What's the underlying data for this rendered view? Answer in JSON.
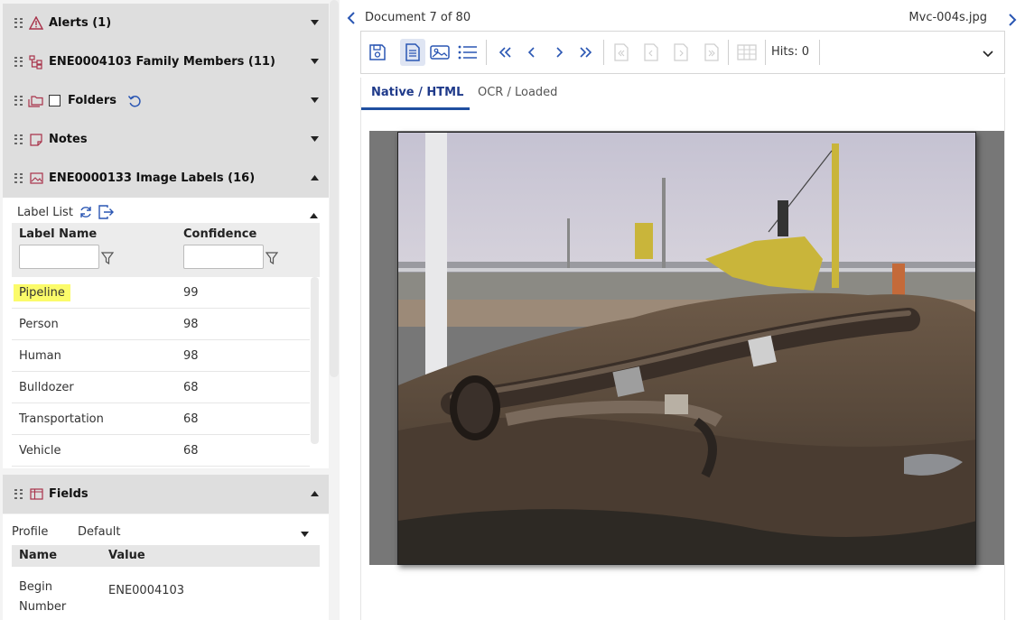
{
  "sections": {
    "alerts": "Alerts (1)",
    "family": "ENE0004103 Family Members (11)",
    "folders": "Folders",
    "notes": "Notes",
    "image_labels": "ENE0000133 Image Labels (16)",
    "fields": "Fields"
  },
  "label_list": {
    "title": "Label List",
    "col_name": "Label Name",
    "col_confidence": "Confidence",
    "rows": [
      {
        "name": "Pipeline",
        "confidence": "99"
      },
      {
        "name": "Person",
        "confidence": "98"
      },
      {
        "name": "Human",
        "confidence": "98"
      },
      {
        "name": "Bulldozer",
        "confidence": "68"
      },
      {
        "name": "Transportation",
        "confidence": "68"
      },
      {
        "name": "Vehicle",
        "confidence": "68"
      }
    ]
  },
  "fields": {
    "profile_label": "Profile",
    "profile_value": "Default",
    "col_name": "Name",
    "col_value": "Value",
    "row_name": "Begin Number",
    "row_value": "ENE0004103"
  },
  "viewer": {
    "doc_count": "Document 7 of 80",
    "file_name": "Mvc-004s.jpg",
    "hits": "Hits: 0",
    "tab_native": "Native / HTML",
    "tab_ocr": "OCR / Loaded"
  },
  "colors": {
    "accent": "#1f4fa0",
    "icon_red": "#a8324a",
    "highlight": "#fbfb6a"
  }
}
